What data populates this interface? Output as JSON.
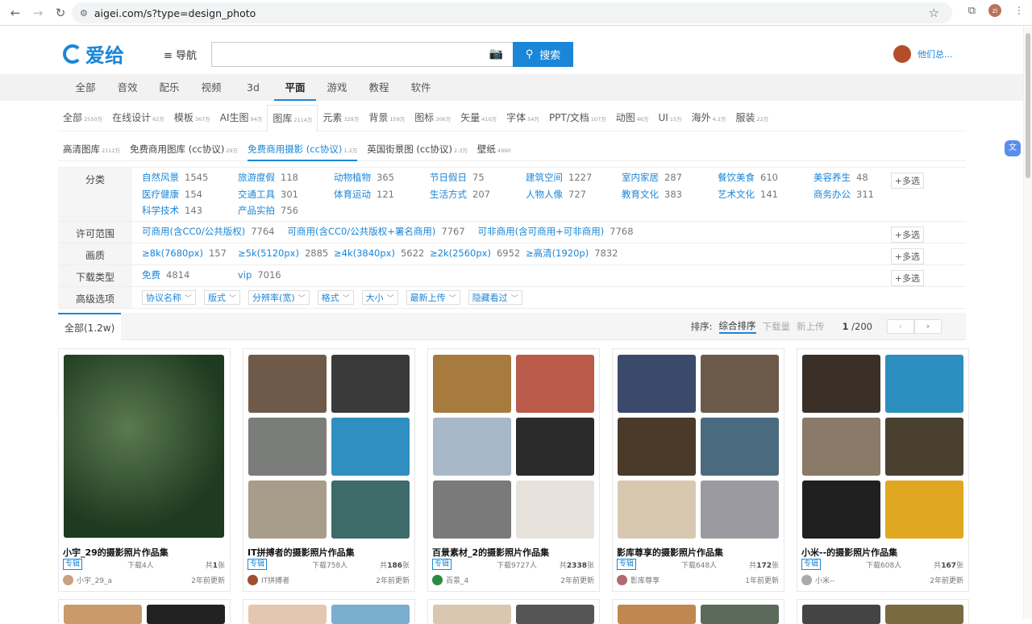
{
  "browser": {
    "url": "aigei.com/s?type=design_photo",
    "profile_initial": "zi"
  },
  "header": {
    "logo_text": "爱给",
    "nav_label": "≡ 导航",
    "search_button": "搜索",
    "user_name": "他们总..."
  },
  "categories": [
    "全部",
    "音效",
    "配乐",
    "视频",
    "3d",
    "平面",
    "游戏",
    "教程",
    "软件"
  ],
  "category_active": "平面",
  "subtabs": [
    {
      "label": "全部",
      "count": "2550万"
    },
    {
      "label": "在线设计",
      "count": "62万"
    },
    {
      "label": "模板",
      "count": "367万"
    },
    {
      "label": "AI生图",
      "count": "94万"
    },
    {
      "label": "图库",
      "count": "2114万"
    },
    {
      "label": "元素",
      "count": "329万"
    },
    {
      "label": "背景",
      "count": "159万"
    },
    {
      "label": "图标",
      "count": "306万"
    },
    {
      "label": "矢量",
      "count": "410万"
    },
    {
      "label": "字体",
      "count": "54万"
    },
    {
      "label": "PPT/文档",
      "count": "107万"
    },
    {
      "label": "动图",
      "count": "46万"
    },
    {
      "label": "UI",
      "count": "15万"
    },
    {
      "label": "海外",
      "count": "4.2万"
    },
    {
      "label": "服装",
      "count": "22万"
    }
  ],
  "subtabs2": [
    {
      "label": "高清图库",
      "count": "2112万"
    },
    {
      "label": "免费商用图库 (cc协议)",
      "count": "29万"
    },
    {
      "label": "免费商用摄影 (cc协议)",
      "count": "1.2万"
    },
    {
      "label": "英国街景图 (cc协议)",
      "count": "2.3万"
    },
    {
      "label": "壁纸",
      "count": "4990"
    }
  ],
  "filters": {
    "category": {
      "label": "分类",
      "options": [
        {
          "name": "自然风景",
          "n": "1545"
        },
        {
          "name": "旅游度假",
          "n": "118"
        },
        {
          "name": "动物植物",
          "n": "365"
        },
        {
          "name": "节日假日",
          "n": "75"
        },
        {
          "name": "建筑空间",
          "n": "1227"
        },
        {
          "name": "室内家居",
          "n": "287"
        },
        {
          "name": "餐饮美食",
          "n": "610"
        },
        {
          "name": "美容养生",
          "n": "48"
        },
        {
          "name": "医疗健康",
          "n": "154"
        },
        {
          "name": "交通工具",
          "n": "301"
        },
        {
          "name": "体育运动",
          "n": "121"
        },
        {
          "name": "生活方式",
          "n": "207"
        },
        {
          "name": "人物人像",
          "n": "727"
        },
        {
          "name": "教育文化",
          "n": "383"
        },
        {
          "name": "艺术文化",
          "n": "141"
        },
        {
          "name": "商务办公",
          "n": "311"
        },
        {
          "name": "科学技术",
          "n": "143"
        },
        {
          "name": "产品实拍",
          "n": "756"
        }
      ]
    },
    "license": {
      "label": "许可范围",
      "options": [
        {
          "name": "可商用(含CC0/公共版权)",
          "n": "7764"
        },
        {
          "name": "可商用(含CC0/公共版权+署名商用)",
          "n": "7767"
        },
        {
          "name": "可非商用(含可商用+可非商用)",
          "n": "7768"
        }
      ]
    },
    "quality": {
      "label": "画质",
      "options": [
        {
          "name": "≥8k(7680px)",
          "n": "157"
        },
        {
          "name": "≥5k(5120px)",
          "n": "2885"
        },
        {
          "name": "≥4k(3840px)",
          "n": "5622"
        },
        {
          "name": "≥2k(2560px)",
          "n": "6952"
        },
        {
          "name": "≥高清(1920p)",
          "n": "7832"
        }
      ]
    },
    "download": {
      "label": "下载类型",
      "options": [
        {
          "name": "免费",
          "n": "4814"
        },
        {
          "name": "vip",
          "n": "7016"
        }
      ]
    },
    "advanced": {
      "label": "高级选项",
      "dropdowns": [
        "协议名称",
        "版式",
        "分辨率(宽)",
        "格式",
        "大小",
        "最新上传",
        "隐藏看过"
      ]
    },
    "multi_label": "+多选"
  },
  "results": {
    "all_tab": "全部(1.2w)",
    "sort_label": "排序:",
    "sort_options": [
      "综合排序",
      "下载量",
      "新上传"
    ],
    "page": "1",
    "page_total": "/200"
  },
  "cards": [
    {
      "title": "小宇_29的摄影照片作品集",
      "tag": "专辑",
      "downloads": "下载4人",
      "total_prefix": "共",
      "total": "1",
      "total_suffix": "张",
      "author": "小宇_29_a",
      "updated": "2年前更新"
    },
    {
      "title": "IT拼搏者的摄影照片作品集",
      "tag": "专辑",
      "downloads": "下载758人",
      "total_prefix": "共",
      "total": "186",
      "total_suffix": "张",
      "author": "IT拼搏者",
      "updated": "2年前更新"
    },
    {
      "title": "百景素材_2的摄影照片作品集",
      "tag": "专辑",
      "downloads": "下载9727人",
      "total_prefix": "共",
      "total": "2338",
      "total_suffix": "张",
      "author": "百景_4",
      "updated": "2年前更新"
    },
    {
      "title": "影库尊享的摄影照片作品集",
      "tag": "专辑",
      "downloads": "下载648人",
      "total_prefix": "共",
      "total": "172",
      "total_suffix": "张",
      "author": "影库尊享",
      "updated": "1年前更新"
    },
    {
      "title": "小米--的摄影照片作品集",
      "tag": "专辑",
      "downloads": "下载608人",
      "total_prefix": "共",
      "total": "167",
      "total_suffix": "张",
      "author": "小米--",
      "updated": "2年前更新"
    }
  ],
  "colors": {
    "accent": "#1a86d8"
  }
}
